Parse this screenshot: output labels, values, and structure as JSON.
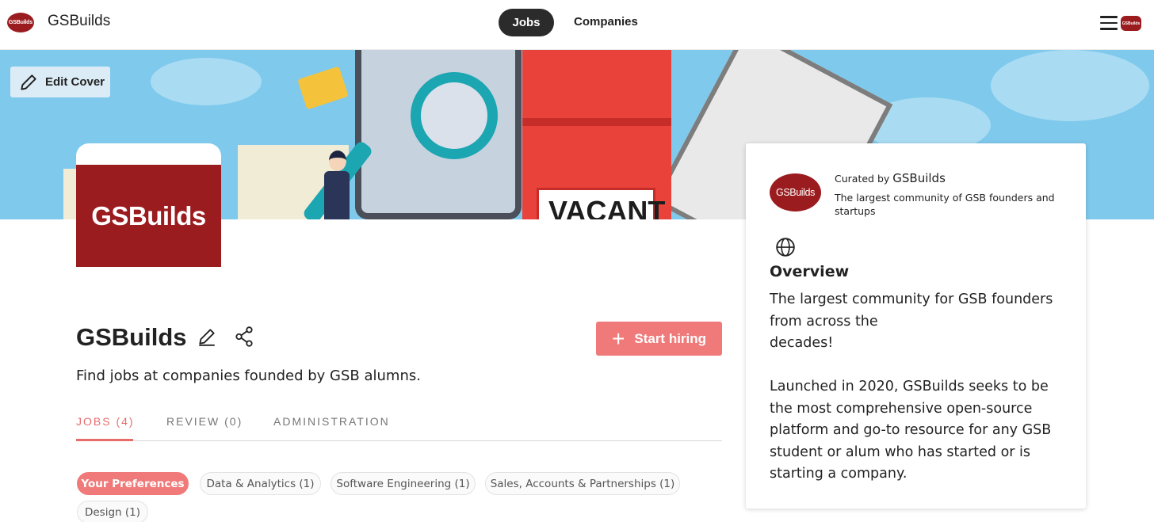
{
  "topnav": {
    "logo_text": "GSBuilds",
    "brand": "GSBuilds",
    "jobs_label": "Jobs",
    "companies_label": "Companies",
    "avatar_text": "GSBuilds",
    "colors": {
      "active_pill": "#2b2b2b"
    }
  },
  "cover": {
    "edit_label": "Edit Cover",
    "sign_text": "VACANT"
  },
  "profile": {
    "logo_text": "GSBuilds",
    "title": "GSBuilds",
    "tagline": "Find jobs at companies founded by GSB alumns.",
    "start_hiring_label": "Start hiring",
    "colors": {
      "accent": "#f07a7a",
      "brand": "#9b1c1f"
    }
  },
  "tabs": [
    {
      "label": "JOBS (4)",
      "active": true
    },
    {
      "label": "REVIEW (0)",
      "active": false
    },
    {
      "label": "ADMINISTRATION",
      "active": false
    }
  ],
  "filters": [
    {
      "label": "Your Preferences",
      "active": true
    },
    {
      "label": "Data & Analytics (1)",
      "active": false
    },
    {
      "label": "Software Engineering (1)",
      "active": false
    },
    {
      "label": "Sales, Accounts & Partnerships (1)",
      "active": false
    },
    {
      "label": "Design (1)",
      "active": false
    }
  ],
  "card": {
    "logo_text": "GSBuilds",
    "curated_prefix": "Curated by",
    "curated_name": "GSBuilds",
    "curated_desc": "The largest community of GSB founders and startups",
    "overview_title": "Overview",
    "overview_p1": "The largest community for GSB founders\nfrom across the\ndecades!",
    "overview_p2": "Launched in 2020, GSBuilds seeks to be\nthe most comprehensive open-source\nplatform and go-to resource for any GSB\nstudent or alum who has started or is\nstarting a company."
  }
}
